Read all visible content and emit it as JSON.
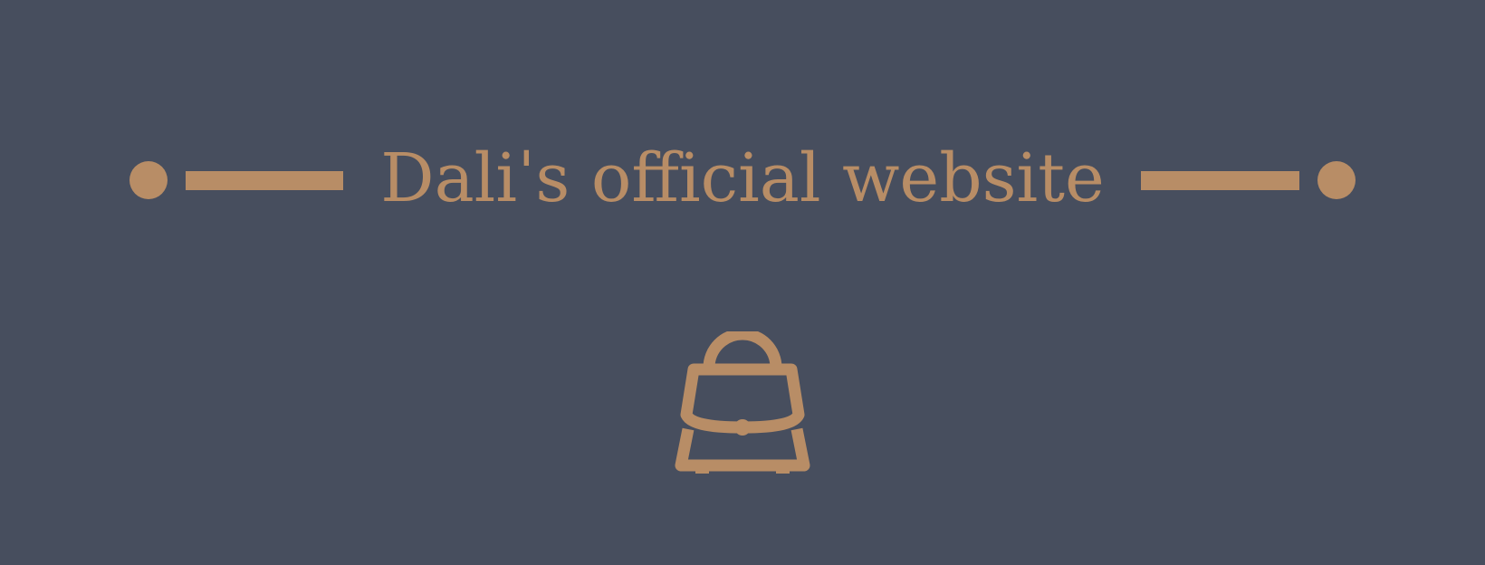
{
  "banner": {
    "title": "Daliˈs official website",
    "accent_color": "#b88d66",
    "background_color": "#474e5e",
    "icon": "handbag-icon"
  }
}
